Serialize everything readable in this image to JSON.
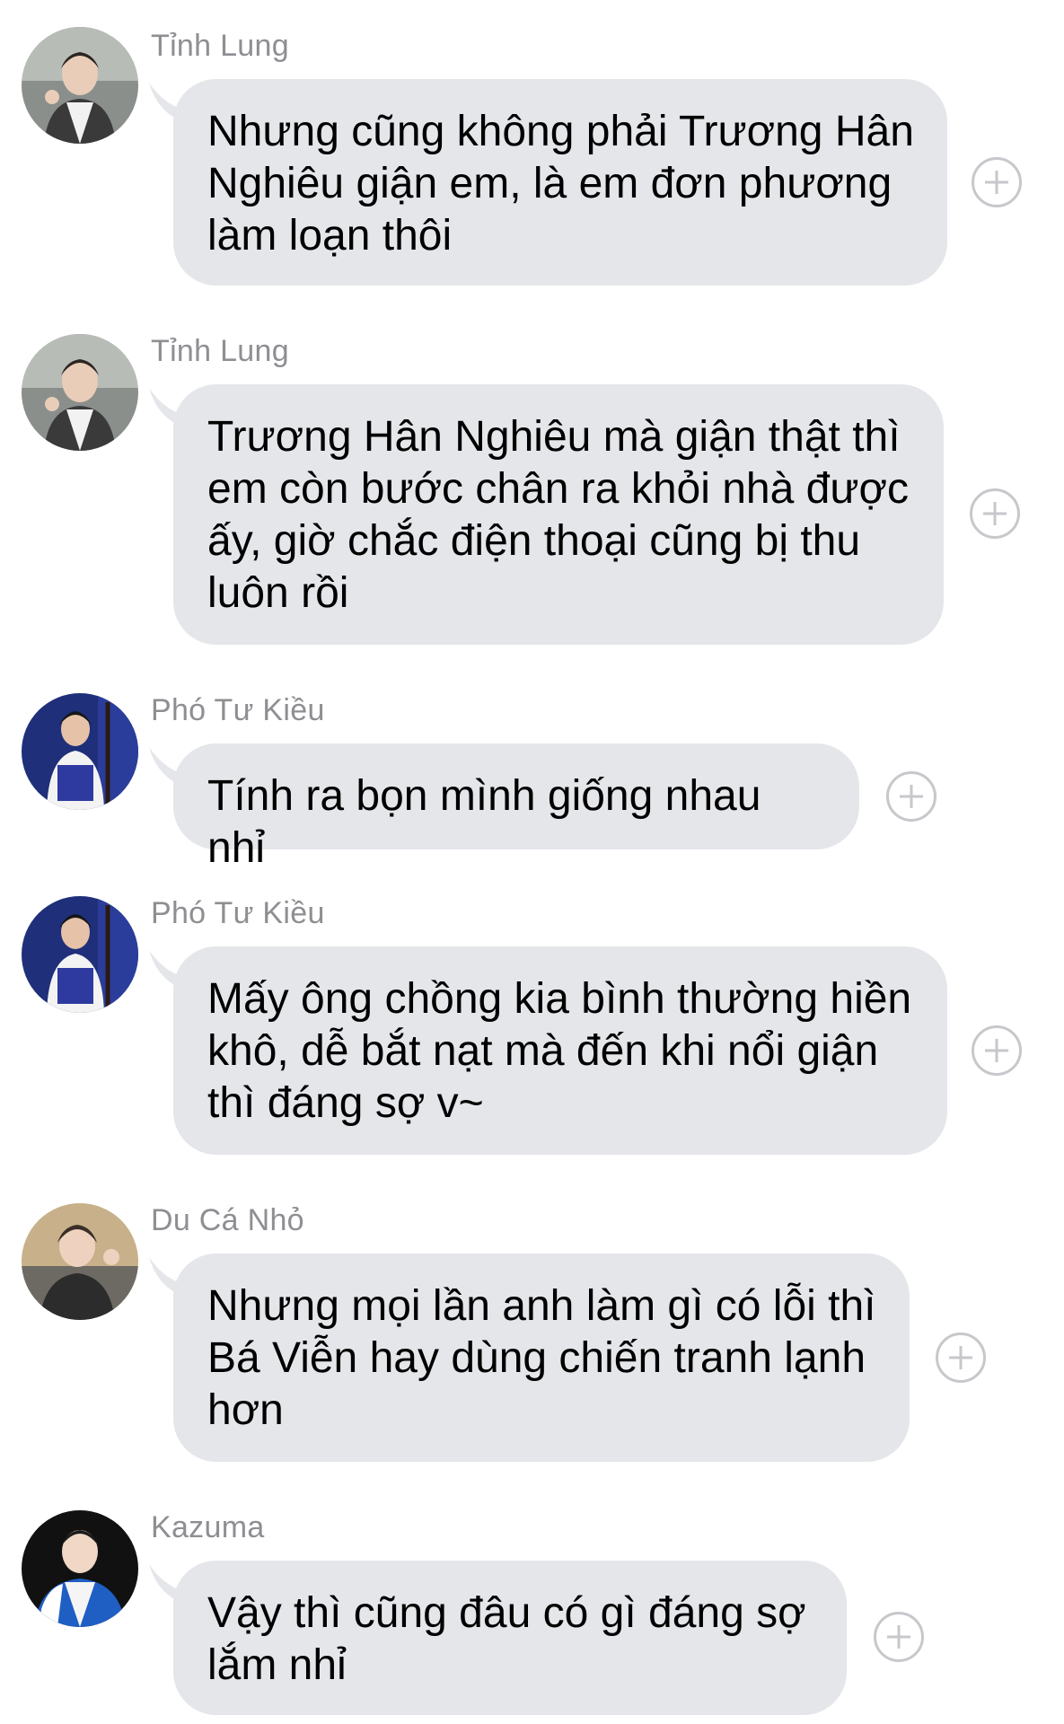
{
  "messages": [
    {
      "sender": "Tỉnh Lung",
      "avatar_icon": "user-avatar-photo",
      "text": "Nhưng cũng không phải Trương Hân Nghiêu giận em, là em đơn phương làm loạn thôi"
    },
    {
      "sender": "Tỉnh Lung",
      "avatar_icon": "user-avatar-photo",
      "text": "Trương Hân Nghiêu mà giận thật thì em còn bước chân ra khỏi nhà được ấy, giờ chắc điện thoại cũng bị thu luôn rồi"
    },
    {
      "sender": "Phó Tư Kiều",
      "avatar_icon": "user-avatar-photo",
      "text": "Tính ra bọn mình giống nhau nhỉ"
    },
    {
      "sender": "Phó Tư Kiều",
      "avatar_icon": "user-avatar-photo",
      "text": "Mấy ông chồng kia bình thường hiền khô, dễ bắt nạt mà đến khi nổi giận thì đáng sợ v~"
    },
    {
      "sender": "Du Cá Nhỏ",
      "avatar_icon": "user-avatar-photo",
      "text": "Nhưng mọi lần anh làm gì có lỗi thì Bá Viễn hay dùng chiến tranh lạnh hơn"
    },
    {
      "sender": "Kazuma",
      "avatar_icon": "user-avatar-photo",
      "text": "Vậy thì cũng đâu có gì đáng sợ lắm nhỉ"
    }
  ],
  "colors": {
    "bubble": "#e5e6ea",
    "sender_text": "#8e8e93",
    "add_icon": "#c7c7cc"
  },
  "icons": {
    "add_reaction": "plus-circle-icon"
  }
}
